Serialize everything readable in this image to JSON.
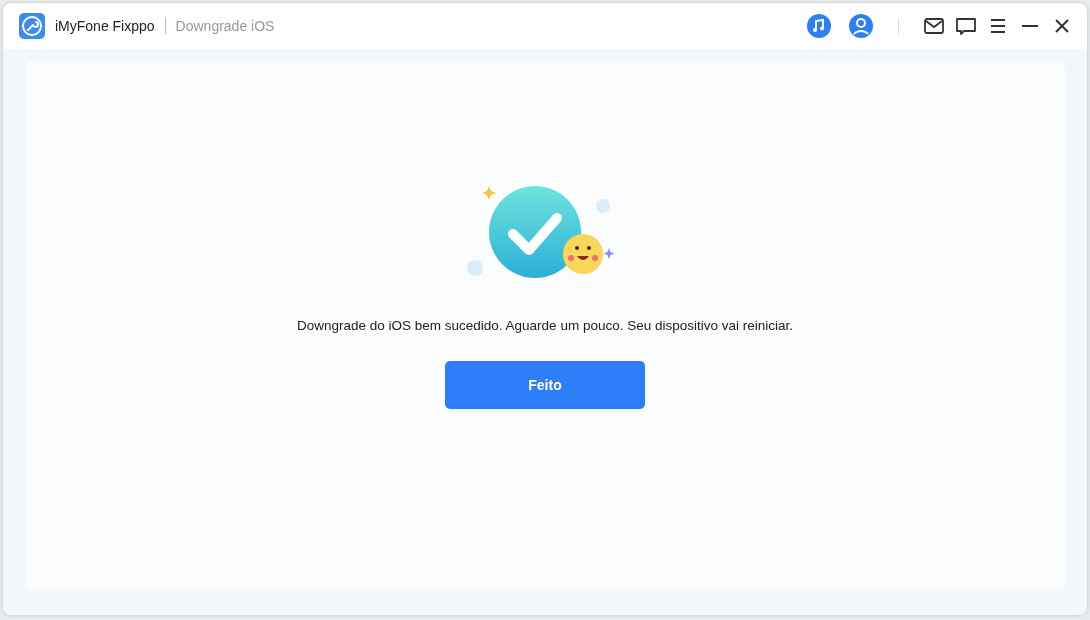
{
  "window": {
    "app_name": "iMyFone Fixppo",
    "section": "Downgrade iOS"
  },
  "message": "Downgrade do iOS bem sucedido. Aguarde um pouco. Seu dispositivo vai reiniciar.",
  "button": "Feito"
}
